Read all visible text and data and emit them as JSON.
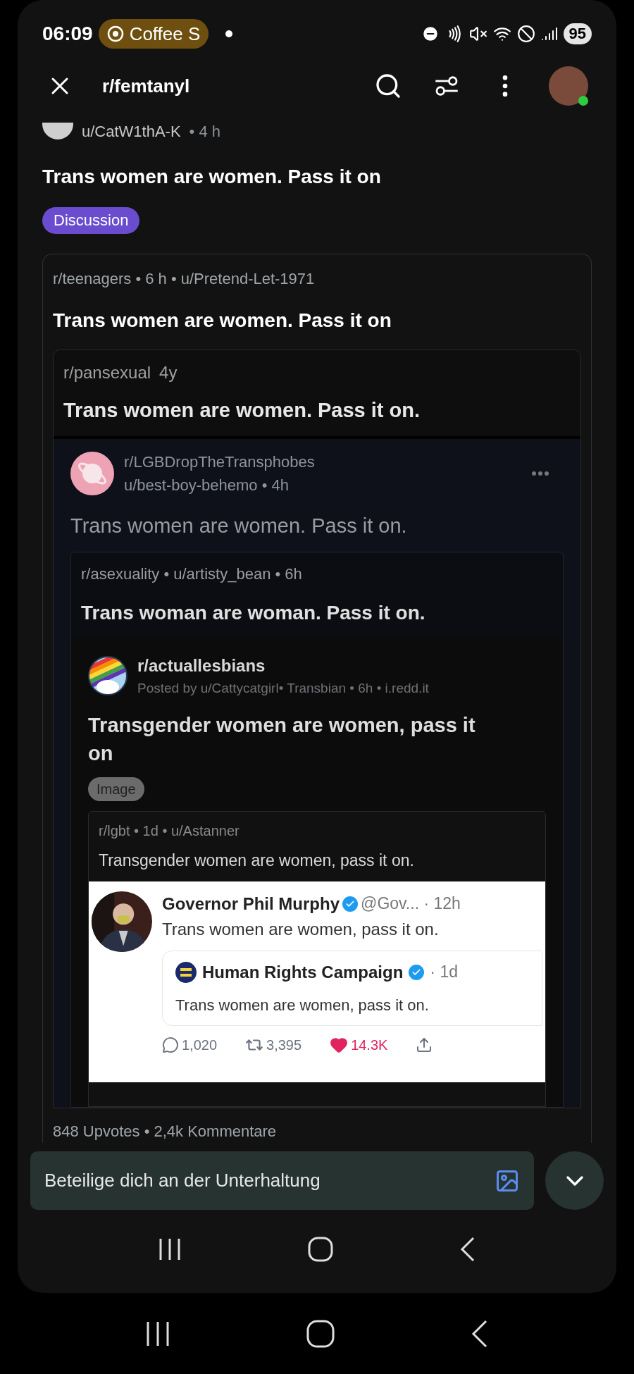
{
  "status_bar": {
    "time": "06:09",
    "media_pill": "Coffee S",
    "battery": "95"
  },
  "header": {
    "title": "r/femtanyl"
  },
  "post": {
    "author": "u/CatW1thA-K",
    "time": "• 4 h",
    "title": "Trans women are women. Pass it on",
    "flair": "Discussion"
  },
  "crosspost": {
    "meta": "r/teenagers • 6 h • u/Pretend-Let-1971",
    "title": "Trans women are women. Pass it on",
    "screenshot": {
      "pansexual": {
        "subreddit": "r/pansexual",
        "age": "4y",
        "title": "Trans women are women. Pass it on."
      },
      "lgb": {
        "subreddit": "r/LGBDropTheTransphobes",
        "user_meta": "u/best-boy-behemo • 4h",
        "body": "Trans women are women. Pass it on."
      },
      "asexuality": {
        "meta": "r/asexuality • u/artisty_bean • 6h",
        "title": "Trans woman are woman. Pass it on."
      },
      "actuallesbians": {
        "subreddit": "r/actuallesbians",
        "byline": "Posted by u/Cattycatgirl• Transbian • 6h • i.redd.it",
        "title": "Transgender women are women, pass it on",
        "flair": "Image"
      },
      "lgbt": {
        "meta": "r/lgbt • 1d • u/Astanner",
        "title": "Transgender women are women, pass it on."
      },
      "tweet": {
        "author": "Governor Phil Murphy",
        "handle_time": "@Gov... · 12h",
        "text": "Trans women are women, pass it on.",
        "quote": {
          "author": "Human Rights Campaign",
          "time": "· 1d",
          "text": "Trans women are women, pass it on."
        },
        "stats": [
          {
            "kind": "reply",
            "count": "1,020"
          },
          {
            "kind": "retweet",
            "count": "3,395"
          },
          {
            "kind": "like",
            "count": "14.3K"
          },
          {
            "kind": "share"
          }
        ]
      }
    },
    "footer": "848 Upvotes • 2,4k Kommentare"
  },
  "composer": {
    "placeholder": "Beteilige dich an der Unterhaltung"
  }
}
